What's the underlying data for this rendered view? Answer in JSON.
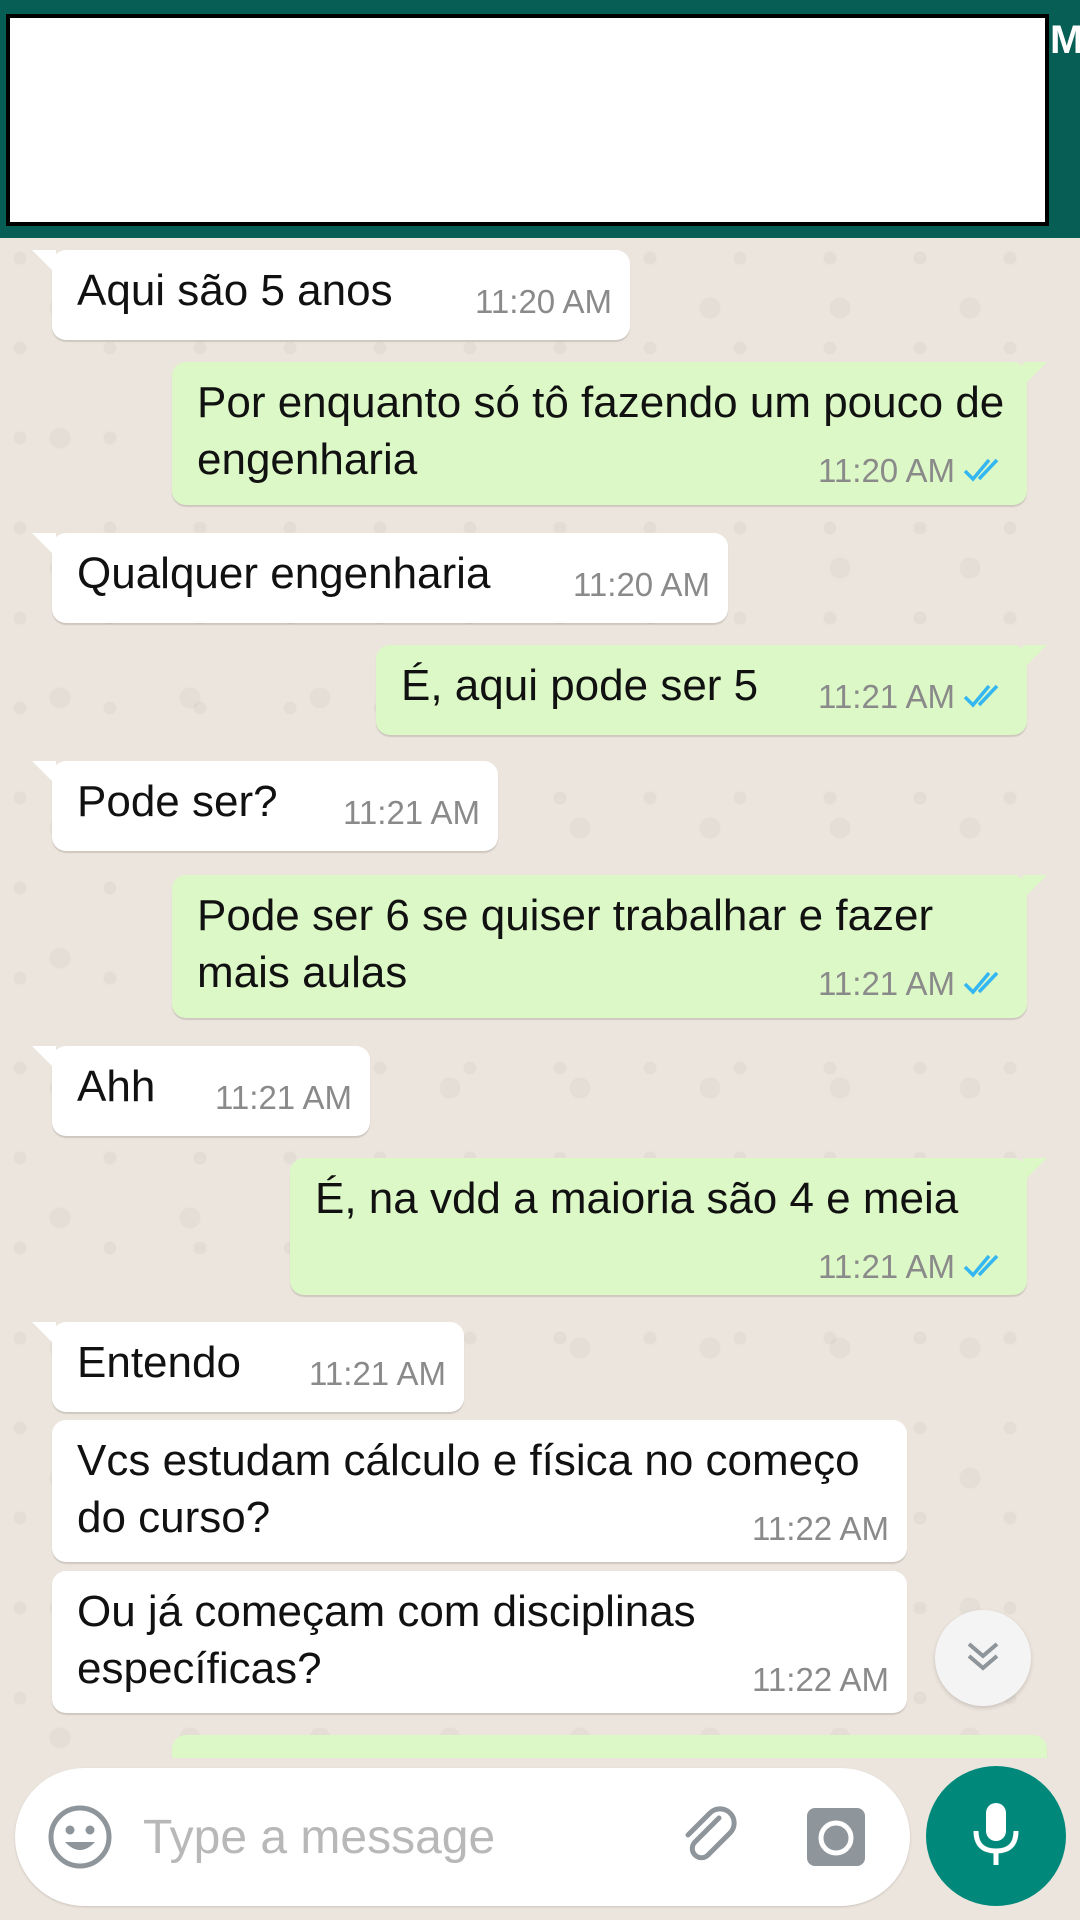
{
  "header": {
    "edge_glyph": "M"
  },
  "messages": [
    {
      "text": "Aqui são 5 anos",
      "time": "11:20 AM",
      "direction": "in"
    },
    {
      "text": "Por enquanto só tô fazendo um pouco de engenharia",
      "time": "11:20 AM",
      "direction": "out"
    },
    {
      "text": "Qualquer engenharia",
      "time": "11:20 AM",
      "direction": "in"
    },
    {
      "text": "É, aqui pode ser 5",
      "time": "11:21 AM",
      "direction": "out"
    },
    {
      "text": "Pode ser?",
      "time": "11:21 AM",
      "direction": "in"
    },
    {
      "text": "Pode ser 6 se quiser trabalhar e fazer mais aulas",
      "time": "11:21 AM",
      "direction": "out"
    },
    {
      "text": "Ahh",
      "time": "11:21 AM",
      "direction": "in"
    },
    {
      "text": "É, na vdd a maioria são 4 e meia",
      "time": "11:21 AM",
      "direction": "out"
    },
    {
      "text": "Entendo",
      "time": "11:21 AM",
      "direction": "in"
    },
    {
      "text": "Vcs estudam cálculo e física no começo do curso?",
      "time": "11:22 AM",
      "direction": "in"
    },
    {
      "text": "Ou já começam com disciplinas específicas?",
      "time": "11:22 AM",
      "direction": "in"
    }
  ],
  "input": {
    "placeholder": "Type a message"
  },
  "colors": {
    "header": "#075e54",
    "outgoing": "#dcf8c6",
    "incoming": "#ffffff",
    "accent": "#00897b",
    "read_ticks": "#34b7f1"
  },
  "icons": [
    "emoji-icon",
    "attach-icon",
    "camera-icon",
    "mic-icon",
    "scroll-down-icon",
    "double-check-icon"
  ]
}
